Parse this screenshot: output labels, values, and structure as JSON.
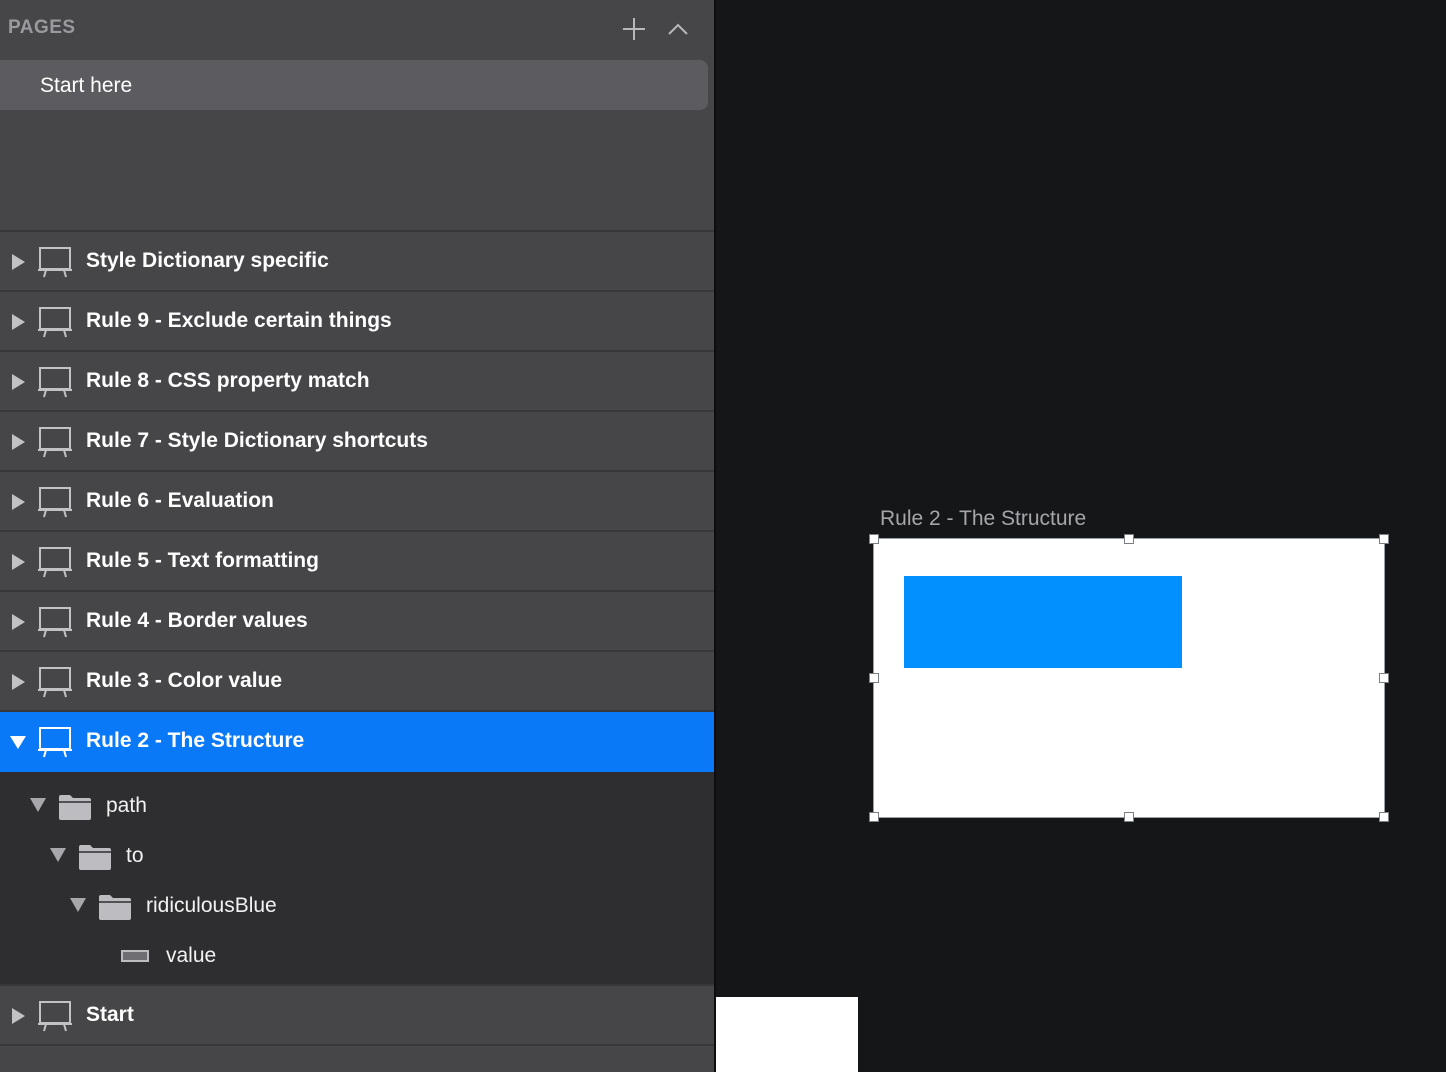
{
  "pages_panel": {
    "title": "PAGES",
    "add_icon": "plus-icon",
    "collapse_icon": "chevron-up-icon",
    "pages": [
      {
        "label": "Start here",
        "selected": true
      }
    ]
  },
  "layers": {
    "artboards": [
      {
        "label": "Style Dictionary specific",
        "expanded": false
      },
      {
        "label": "Rule 9 - Exclude certain things",
        "expanded": false
      },
      {
        "label": "Rule 8 - CSS property match",
        "expanded": false
      },
      {
        "label": "Rule 7 - Style Dictionary shortcuts",
        "expanded": false
      },
      {
        "label": "Rule 6 - Evaluation",
        "expanded": false
      },
      {
        "label": "Rule 5 - Text formatting",
        "expanded": false
      },
      {
        "label": "Rule 4 - Border values",
        "expanded": false
      },
      {
        "label": "Rule 3 - Color value",
        "expanded": false
      },
      {
        "label": "Rule 2 - The Structure",
        "expanded": true,
        "selected": true
      },
      {
        "label": "Start",
        "expanded": false
      }
    ],
    "children": [
      {
        "label": "path",
        "type": "group"
      },
      {
        "label": "to",
        "type": "group"
      },
      {
        "label": "ridiculousBlue",
        "type": "group"
      },
      {
        "label": "value",
        "type": "rectangle"
      }
    ]
  },
  "canvas": {
    "artboard_title": "Rule 2 - The Structure",
    "shape_color": "#0390ff",
    "selection_color": "#0a79f8"
  }
}
